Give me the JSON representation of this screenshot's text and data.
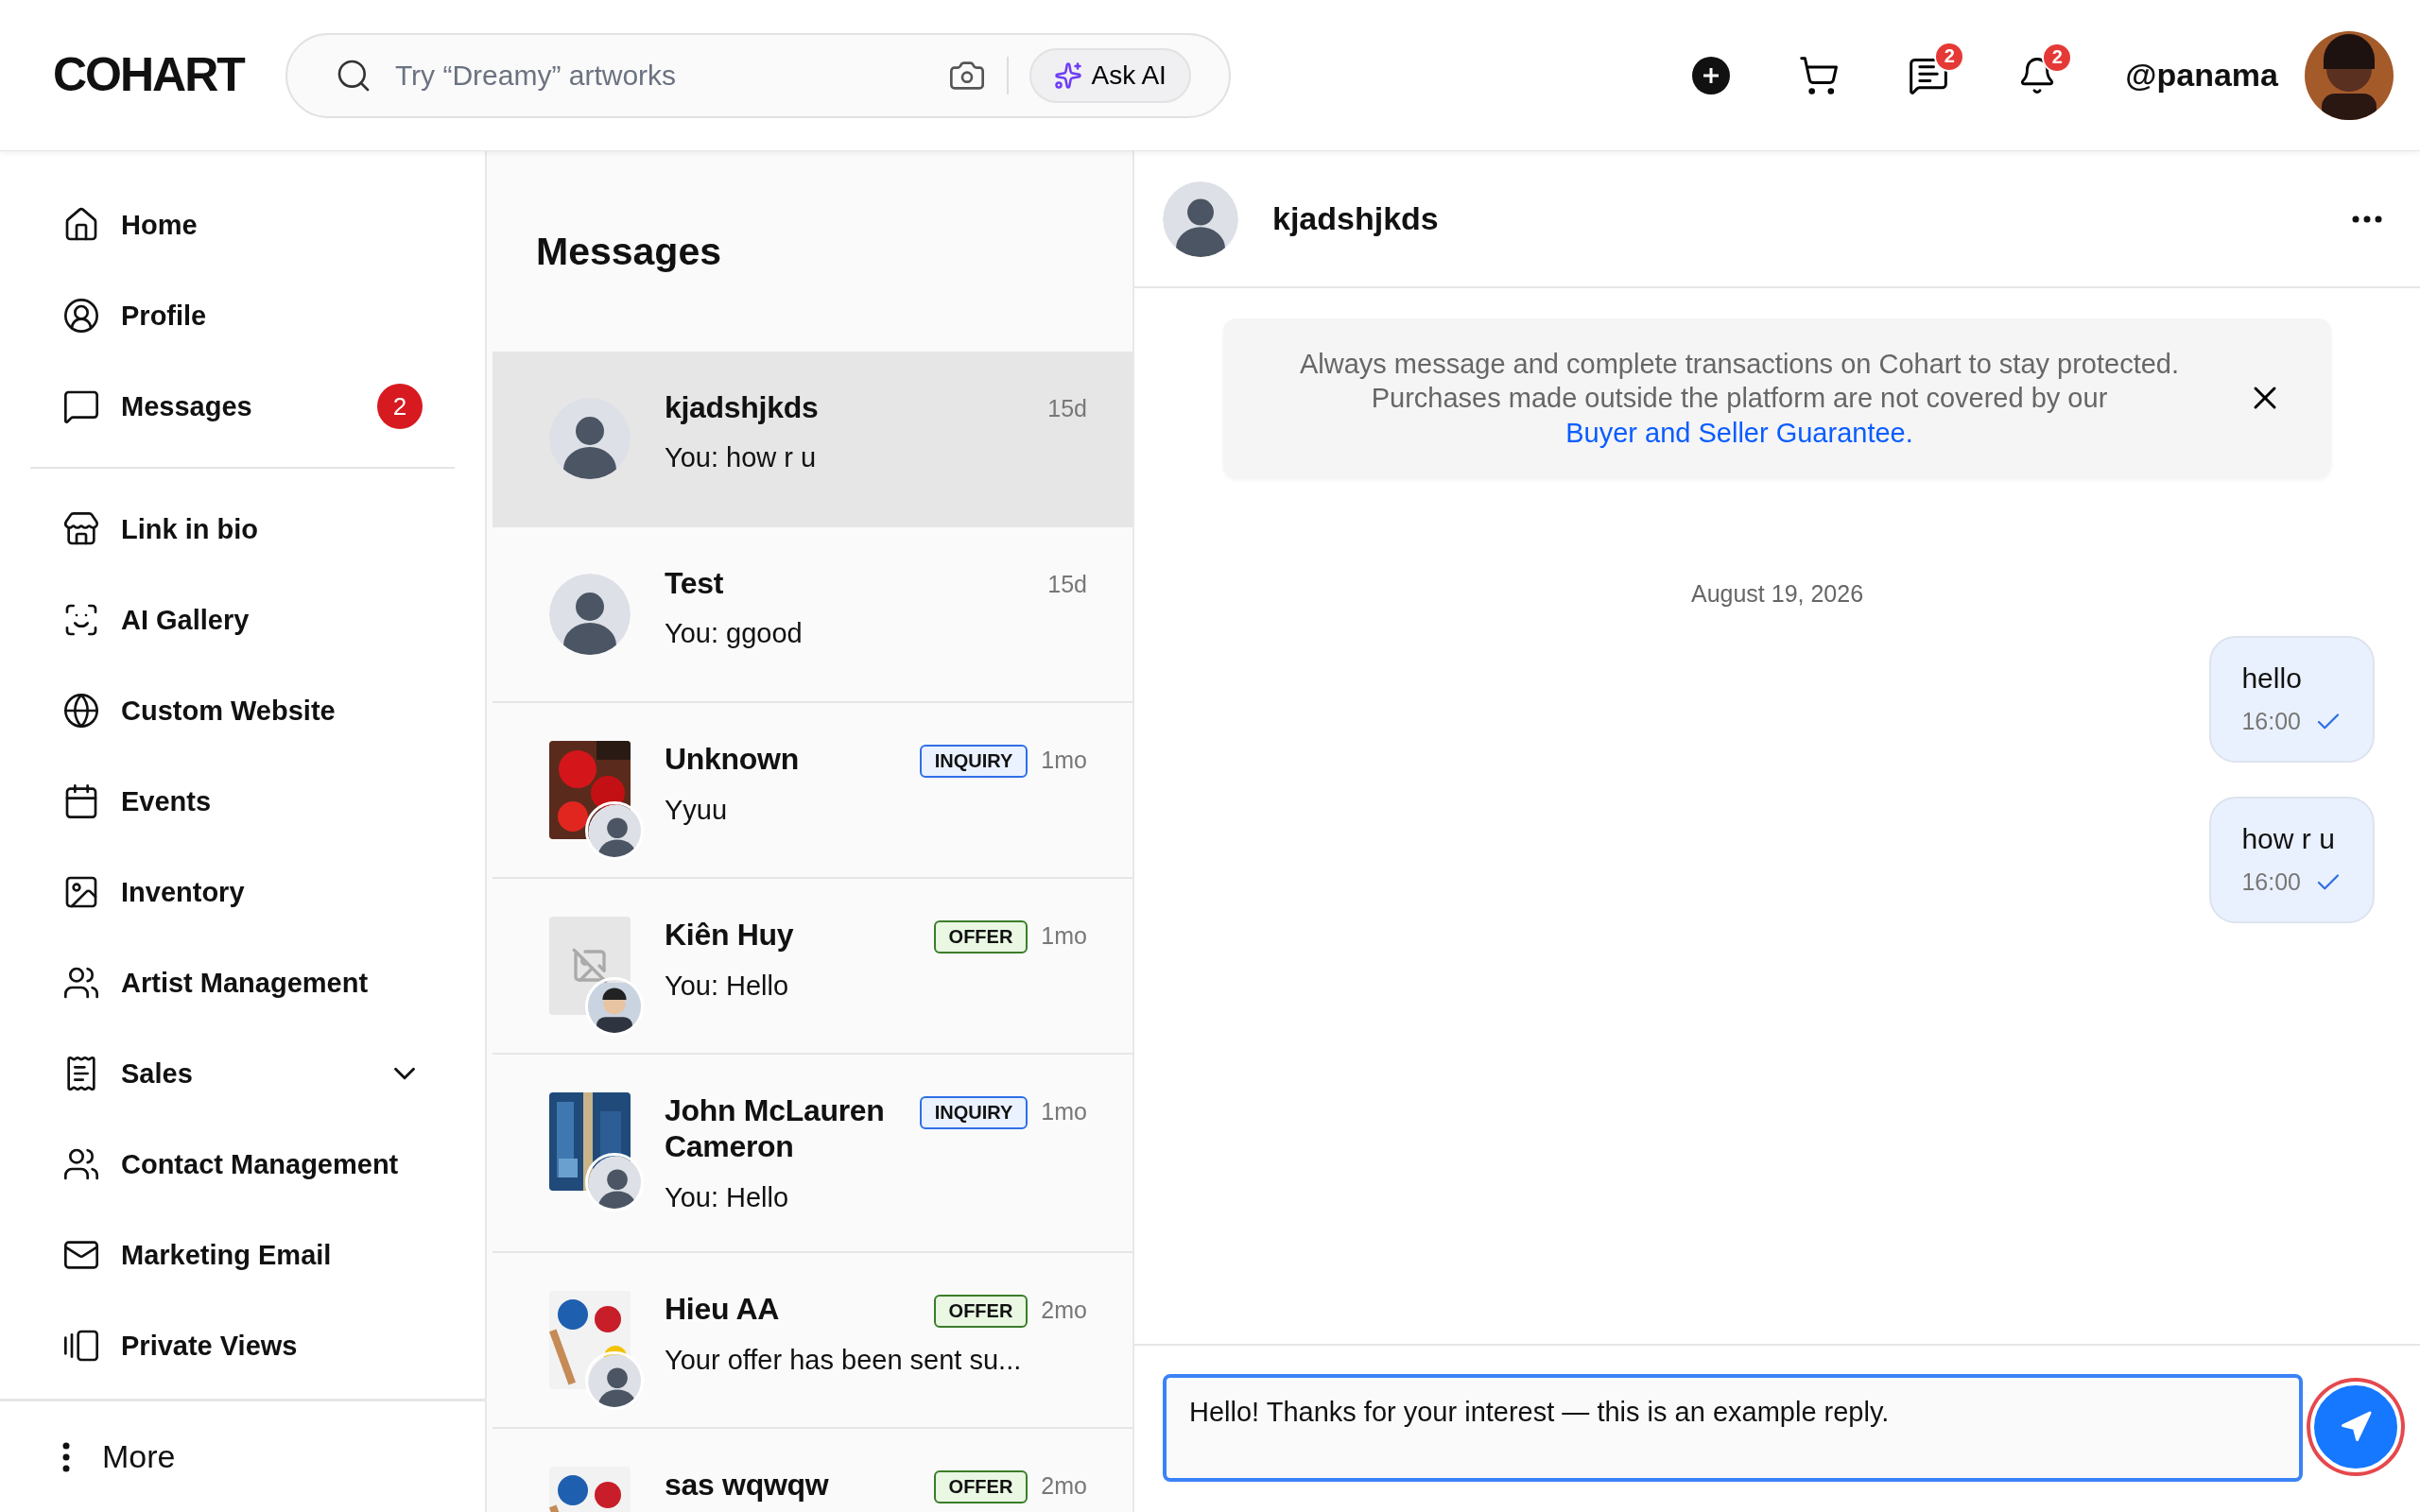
{
  "header": {
    "logo": "COHART",
    "search": {
      "placeholder": "Try “Dreamy” artworks"
    },
    "ask_ai": "Ask AI",
    "message_badge": "2",
    "notification_badge": "2",
    "username": "@panama"
  },
  "sidebar": {
    "sections": [
      {
        "items": [
          {
            "label": "Home"
          },
          {
            "label": "Profile"
          },
          {
            "label": "Messages",
            "badge": "2"
          }
        ]
      },
      {
        "items": [
          {
            "label": "Link in bio"
          },
          {
            "label": "AI Gallery"
          },
          {
            "label": "Custom Website"
          },
          {
            "label": "Events"
          },
          {
            "label": "Inventory"
          },
          {
            "label": "Artist Management"
          },
          {
            "label": "Sales",
            "expanded": false
          },
          {
            "label": "Contact Management"
          },
          {
            "label": "Marketing Email"
          },
          {
            "label": "Private Views"
          }
        ]
      }
    ],
    "more": "More"
  },
  "conversations": {
    "title": "Messages",
    "items": [
      {
        "name": "kjadshjkds",
        "preview": "You: how r u",
        "time": "15d",
        "selected": true,
        "thumb": {
          "kind": "avatar"
        }
      },
      {
        "name": "Test",
        "preview": "You: ggood",
        "time": "15d",
        "selected": false,
        "thumb": {
          "kind": "avatar"
        }
      },
      {
        "name": "Unknown",
        "preview": "Yyuu",
        "time": "1mo",
        "selected": false,
        "tag": {
          "kind": "inquiry",
          "label": "INQUIRY"
        },
        "overlay": {
          "kind": "avatar"
        }
      },
      {
        "name": "Kiên Huy",
        "preview": "You: Hello",
        "time": "1mo",
        "selected": false,
        "thumb": {
          "kind": "placeholder"
        },
        "tag": {
          "kind": "offer",
          "label": "OFFER"
        }
      },
      {
        "name": "John McLauren Cameron",
        "preview": "You: Hello",
        "time": "1mo",
        "selected": false,
        "tag": {
          "kind": "inquiry",
          "label": "INQUIRY"
        },
        "overlay": {
          "kind": "avatar"
        }
      },
      {
        "name": "Hieu AA",
        "preview": "Your offer has been sent su...",
        "time": "2mo",
        "selected": false,
        "tag": {
          "kind": "offer",
          "label": "OFFER"
        },
        "overlay": {
          "kind": "avatar"
        }
      },
      {
        "name": "sas wqwqw",
        "time": "2mo",
        "selected": false,
        "tag": {
          "kind": "offer",
          "label": "OFFER"
        }
      }
    ]
  },
  "chat": {
    "name": "kjadshjkds",
    "notice": {
      "text": "Always message and complete transactions on Cohart to stay protected. Purchases made outside the platform are not covered by our",
      "link": "Buyer and Seller Guarantee."
    },
    "date": "August 19, 2026",
    "messages": [
      {
        "text": "hello",
        "time": "16:00",
        "delivered": true
      },
      {
        "text": "how r u",
        "time": "16:00",
        "delivered": true
      }
    ],
    "composer": {
      "value": "Hello! Thanks for your interest — this is an example reply."
    }
  }
}
